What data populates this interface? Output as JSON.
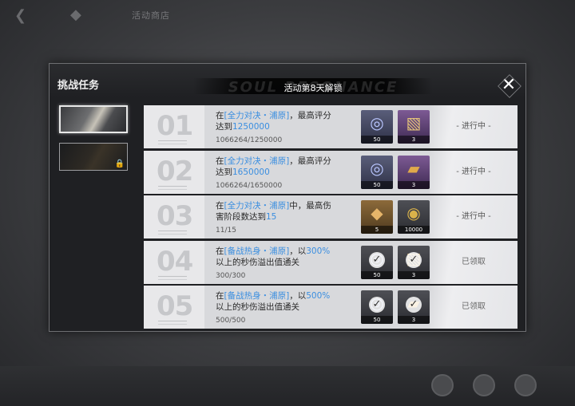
{
  "background": {
    "back_icon": "back-arrow-icon",
    "home_icon": "home-icon",
    "page_title": "活动商店"
  },
  "dialog": {
    "title": "挑战任务",
    "unlock_notice": "活动第8天解锁",
    "watermark": "SOUL RESONANCE",
    "close_icon": "close-icon"
  },
  "characters": [
    {
      "state": "selected"
    },
    {
      "state": "locked",
      "lock_icon": "lock-icon"
    }
  ],
  "tasks": [
    {
      "number": "01",
      "desc_prefix": "在",
      "highlight1": "[全力对决・浦原]",
      "desc_mid": "，最高评分达到",
      "highlight2": "1250000",
      "progress": "1066264/1250000",
      "rewards": [
        {
          "icon": "ring-item-icon",
          "count": "50",
          "rarity": "blue"
        },
        {
          "icon": "book-item-icon",
          "count": "3",
          "rarity": "purple"
        }
      ],
      "status": "- 进行中 -"
    },
    {
      "number": "02",
      "desc_prefix": "在",
      "highlight1": "[全力对决・浦原]",
      "desc_mid": "，最高评分达到",
      "highlight2": "1650000",
      "progress": "1066264/1650000",
      "rewards": [
        {
          "icon": "ring-item-icon",
          "count": "50",
          "rarity": "blue"
        },
        {
          "icon": "gold-bar-icon",
          "count": "3",
          "rarity": "purple"
        }
      ],
      "status": "- 进行中 -"
    },
    {
      "number": "03",
      "desc_prefix": "在",
      "highlight1": "[全力对决・浦原]",
      "desc_mid": "中，最高伤害阶段数达到",
      "highlight2": "15",
      "progress": "11/15",
      "rewards": [
        {
          "icon": "ore-item-icon",
          "count": "5",
          "rarity": "gold"
        },
        {
          "icon": "coin-icon",
          "count": "10000",
          "rarity": "dim"
        }
      ],
      "status": "- 进行中 -"
    },
    {
      "number": "04",
      "desc_prefix": "在",
      "highlight1": "[备战热身・浦原]",
      "desc_mid": "，以",
      "highlight2": "300%",
      "desc_suffix": "以上的秒伤溢出值通关",
      "progress": "300/300",
      "rewards": [
        {
          "icon": "ring-item-icon",
          "count": "50",
          "rarity": "dim",
          "claimed": true
        },
        {
          "icon": "book-item-icon",
          "count": "3",
          "rarity": "dim",
          "claimed": true
        }
      ],
      "status": "已领取"
    },
    {
      "number": "05",
      "desc_prefix": "在",
      "highlight1": "[备战热身・浦原]",
      "desc_mid": "，以",
      "highlight2": "500%",
      "desc_suffix": "以上的秒伤溢出值通关",
      "progress": "500/500",
      "rewards": [
        {
          "icon": "ring-item-icon",
          "count": "50",
          "rarity": "dim",
          "claimed": true
        },
        {
          "icon": "gold-bar-icon",
          "count": "3",
          "rarity": "dim",
          "claimed": true
        }
      ],
      "status": "已领取"
    }
  ]
}
